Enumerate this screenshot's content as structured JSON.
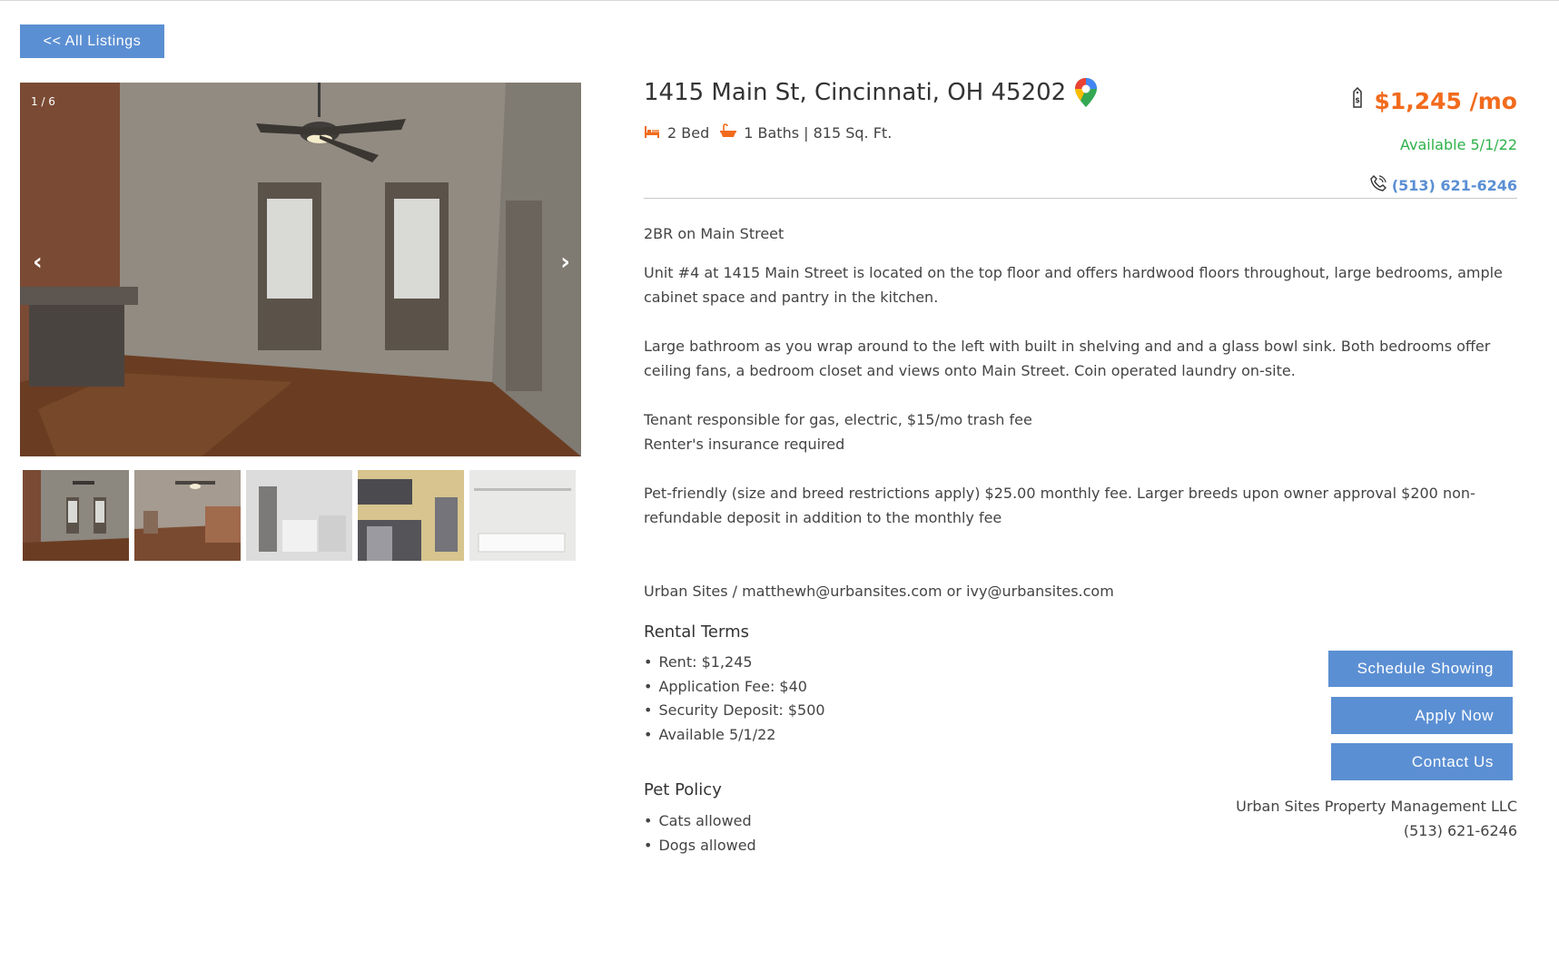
{
  "nav": {
    "back_label": "<< All Listings"
  },
  "gallery": {
    "counter": "1 / 6",
    "prev_arrow": "‹",
    "next_arrow": "›"
  },
  "listing": {
    "address": "1415 Main St, Cincinnati, OH 45202",
    "beds": "2 Bed",
    "baths_sqft": "1 Baths | 815 Sq. Ft.",
    "price": "$1,245 /mo",
    "available": "Available 5/1/22",
    "phone": "(513) 621-6246"
  },
  "description": {
    "headline": "2BR on Main Street",
    "paragraphs": [
      "Unit #4 at 1415 Main Street is located on the top floor and offers hardwood floors throughout, large bedrooms, ample cabinet space and pantry in the kitchen.",
      "Large bathroom as you wrap around to the left with built in shelving and and a glass bowl sink. Both bedrooms offer ceiling fans, a bedroom closet and views onto Main Street. Coin operated laundry on-site.",
      "Tenant responsible for gas, electric, $15/mo trash fee",
      "Renter's insurance required",
      "Pet-friendly (size and breed restrictions apply) $25.00 monthly fee. Larger breeds upon owner approval $200 non-refundable deposit in addition to the monthly fee"
    ],
    "contact": "Urban Sites / matthewh@urbansites.com or ivy@urbansites.com"
  },
  "rental_terms": {
    "title": "Rental Terms",
    "items": [
      "Rent: $1,245",
      "Application Fee: $40",
      "Security Deposit: $500",
      "Available 5/1/22"
    ]
  },
  "pet_policy": {
    "title": "Pet Policy",
    "items": [
      "Cats allowed",
      "Dogs allowed"
    ]
  },
  "actions": {
    "schedule": "Schedule Showing",
    "apply": "Apply Now",
    "contact": "Contact Us"
  },
  "company": {
    "name": "Urban Sites Property Management LLC",
    "phone": "(513) 621-6246"
  },
  "colors": {
    "accent_blue": "#5b8fd3",
    "price_orange": "#f26b1d",
    "available_green": "#2cb24a"
  },
  "icons": [
    "bed-icon",
    "bath-icon",
    "map-pin-icon",
    "price-tag-icon",
    "phone-icon"
  ]
}
